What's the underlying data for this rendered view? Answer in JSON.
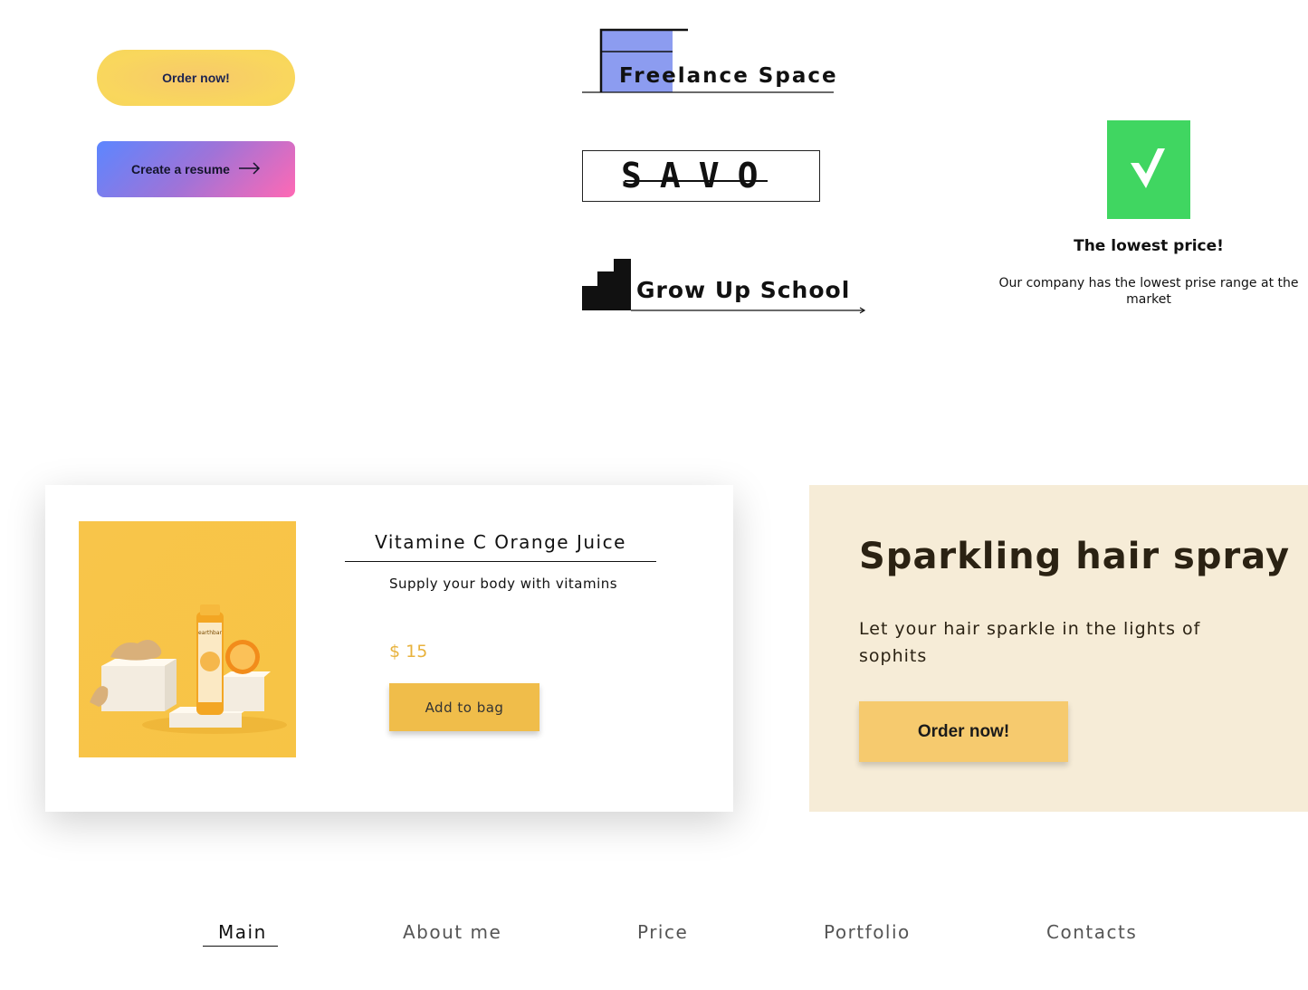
{
  "buttons": {
    "order_now": "Order now!",
    "create_resume": "Create a resume",
    "create_resume_icon": "arrow-right-icon"
  },
  "logos": {
    "freelance_space": "Freelance Space",
    "savo": "SAVO",
    "grow_up_school": "Grow Up School"
  },
  "lowest_price": {
    "icon": "checkmark-icon",
    "title": "The lowest price!",
    "description": "Our company has the lowest prise range at the market"
  },
  "product": {
    "title": "Vitamine C Orange Juice",
    "subtitle": "Supply your body with vitamins",
    "price": "$ 15",
    "add_to_bag": "Add to bag",
    "bottle_label": "earthbar"
  },
  "promo": {
    "title": "Sparkling hair spray",
    "description": "Let your hair sparkle in the lights of sophits",
    "button": "Order now!"
  },
  "nav": {
    "items": [
      "Main",
      "About me",
      "Price",
      "Portfolio",
      "Contacts"
    ],
    "active": "Main"
  },
  "colors": {
    "yellow": "#f9d75d",
    "green": "#40d661",
    "blue_logo": "#8c9cf0",
    "price": "#e8b23c",
    "promo_bg": "#f6ecd7"
  }
}
